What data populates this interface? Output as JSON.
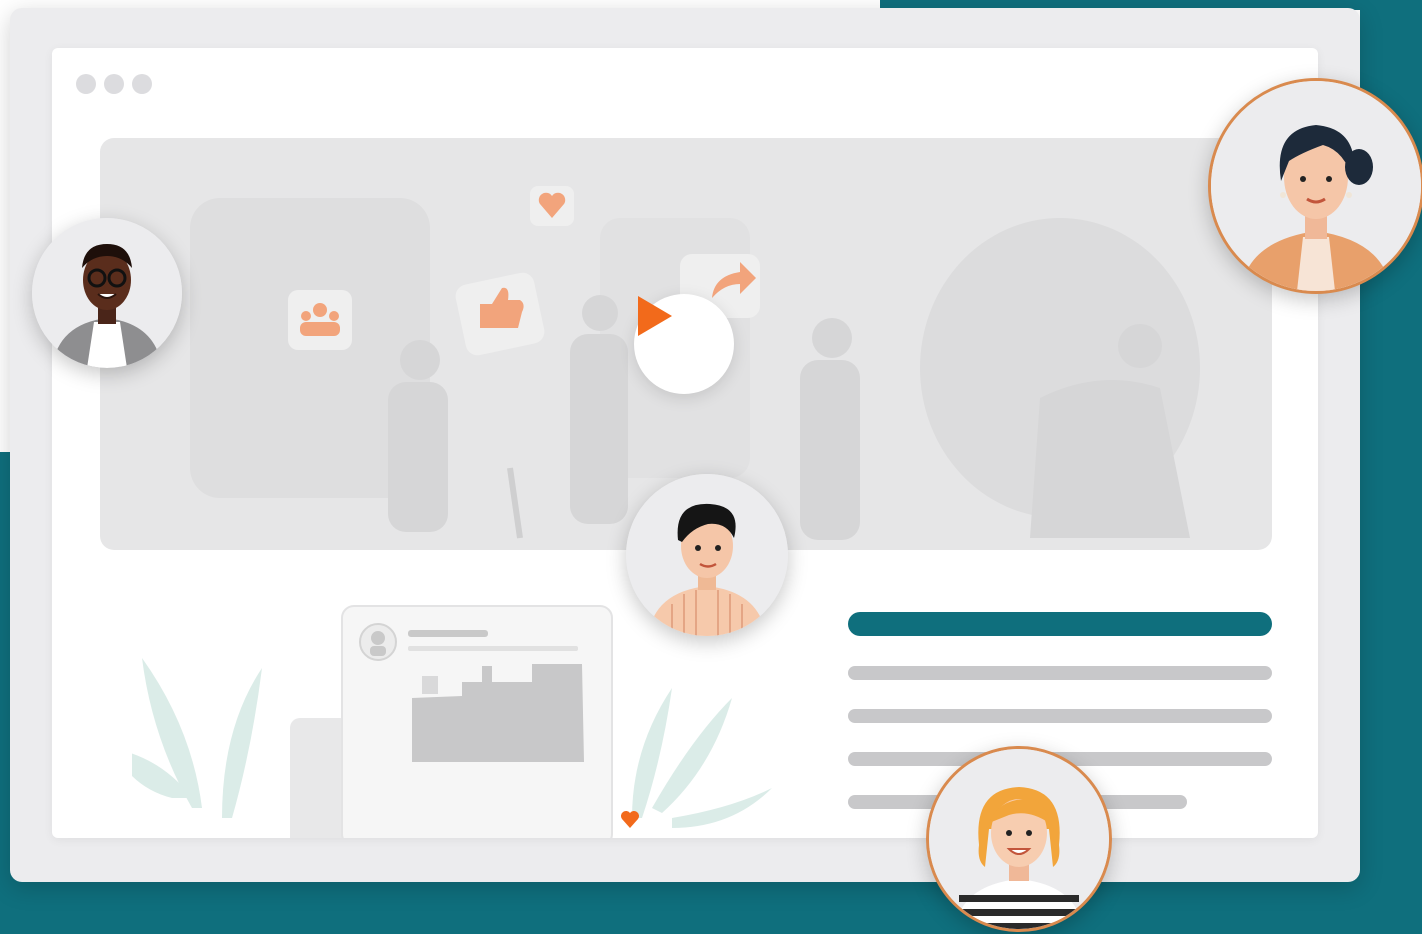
{
  "colors": {
    "teal": "#0f6f7d",
    "accent": "#f26a1b",
    "frame": "#ececee",
    "placeholder_line": "#c8c8ca"
  },
  "window": {
    "controls": [
      "dot",
      "dot",
      "dot"
    ]
  },
  "video": {
    "play_icon": "play-icon",
    "reaction_icons": [
      "heart-icon",
      "community-icon",
      "thumbs-up-icon",
      "share-icon"
    ]
  },
  "post_card": {
    "icons": [
      "avatar-icon",
      "heart-icon"
    ]
  },
  "avatars": [
    "avatar-glasses-man",
    "avatar-dark-hair-woman",
    "avatar-young-man",
    "avatar-blonde-woman"
  ]
}
